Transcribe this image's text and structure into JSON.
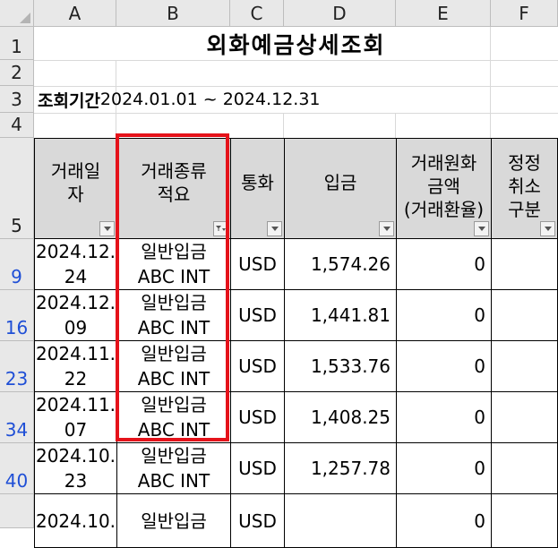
{
  "columns": [
    "A",
    "B",
    "C",
    "D",
    "E",
    "F"
  ],
  "rows": [
    "1",
    "2",
    "3",
    "4",
    "5",
    "9",
    "16",
    "23",
    "34",
    "40"
  ],
  "title": "외화예금상세조회",
  "period": {
    "label": "조회기간",
    "value": "2024.01.01 ~ 2024.12.31"
  },
  "headers": {
    "a": [
      "거래일",
      "자"
    ],
    "b": [
      "거래종류",
      "적요"
    ],
    "c": [
      "통화"
    ],
    "d": [
      "입금"
    ],
    "e": [
      "거래원화",
      "금액",
      "(거래환율)"
    ],
    "f": [
      "정정",
      "취소",
      "구분"
    ]
  },
  "records": [
    {
      "date1": "2024.12.",
      "date2": "24",
      "type": "일반입금",
      "memo": "ABC INT",
      "currency": "USD",
      "deposit": "1,574.26",
      "krw": "0",
      "cancel": ""
    },
    {
      "date1": "2024.12.",
      "date2": "09",
      "type": "일반입금",
      "memo": "ABC INT",
      "currency": "USD",
      "deposit": "1,441.81",
      "krw": "0",
      "cancel": ""
    },
    {
      "date1": "2024.11.",
      "date2": "22",
      "type": "일반입금",
      "memo": "ABC INT",
      "currency": "USD",
      "deposit": "1,533.76",
      "krw": "0",
      "cancel": ""
    },
    {
      "date1": "2024.11.",
      "date2": "07",
      "type": "일반입금",
      "memo": "ABC INT",
      "currency": "USD",
      "deposit": "1,408.25",
      "krw": "0",
      "cancel": ""
    },
    {
      "date1": "2024.10.",
      "date2": "23",
      "type": "일반입금",
      "memo": "ABC INT",
      "currency": "USD",
      "deposit": "1,257.78",
      "krw": "0",
      "cancel": ""
    },
    {
      "date1": "2024.10.",
      "date2": "",
      "type": "일반입금",
      "memo": "",
      "currency": "USD",
      "deposit": "",
      "krw": "0",
      "cancel": ""
    }
  ],
  "colors": {
    "highlight": "#e5121a",
    "filtered_row_number": "#1f4fd6",
    "header_fill": "#d9d9d9"
  },
  "icons": {
    "filter_dropdown": "chevron-down-icon",
    "filter_active": "filter-icon"
  }
}
